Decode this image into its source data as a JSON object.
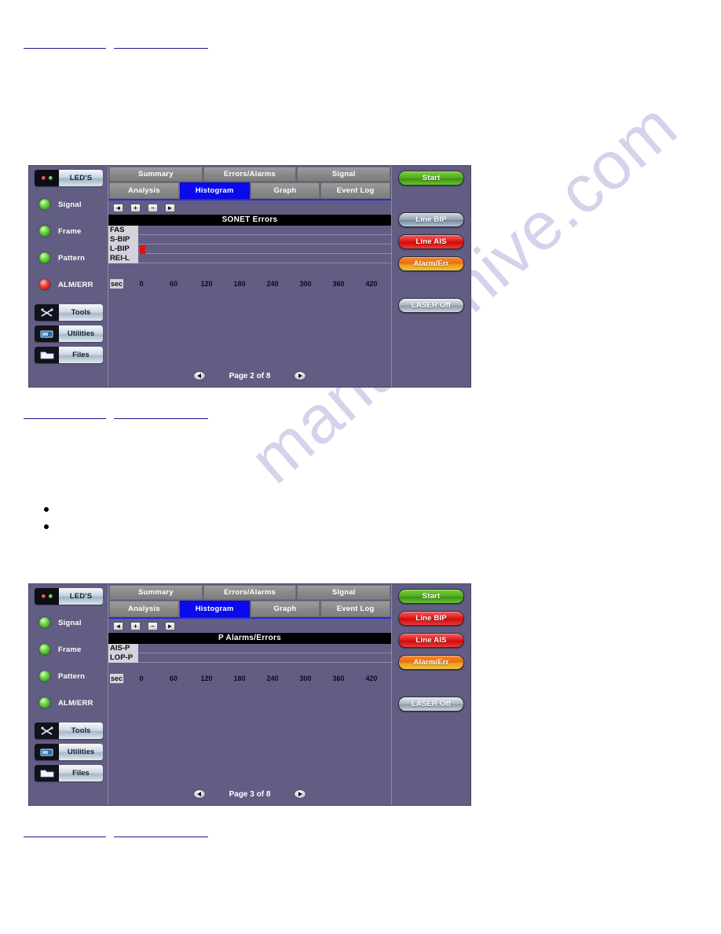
{
  "page": {
    "watermark": "manualshive.com",
    "watermark_color": "#b9badf",
    "background": "#ffffff"
  },
  "theme": {
    "panel_bg": "#625d82",
    "tab_bg": "#8a8a8a",
    "tab_active_bg": "#0a0aee",
    "title_bar_bg": "#000000",
    "gridline": "#8f8ca8",
    "bar_red": "#ee0b0b",
    "label_bg": "#d4d2dd"
  },
  "rules": [
    {
      "a_label": "",
      "b_label": ""
    },
    {
      "a_label": "",
      "b_label": ""
    },
    {
      "a_label": "",
      "b_label": ""
    }
  ],
  "bullets": [
    "",
    ""
  ],
  "screens": [
    {
      "id": "screen-sonet-errors",
      "sidebar": {
        "header": {
          "label": "LED'S",
          "icon": "led-indicator-icon",
          "dots": [
            "red",
            "green"
          ]
        },
        "leds": [
          {
            "label": "Signal",
            "color": "green"
          },
          {
            "label": "Frame",
            "color": "green"
          },
          {
            "label": "Pattern",
            "color": "green"
          },
          {
            "label": "ALM/ERR",
            "color": "red"
          }
        ],
        "tools": [
          {
            "label": "Tools",
            "icon": "tools-icon"
          },
          {
            "label": "Utilities",
            "icon": "utilities-icon"
          },
          {
            "label": "Files",
            "icon": "files-icon"
          }
        ]
      },
      "tabs_row1": [
        {
          "label": "Summary",
          "active": false
        },
        {
          "label": "Errors/Alarms",
          "active": false
        },
        {
          "label": "Signal",
          "active": false
        }
      ],
      "tabs_row2": [
        {
          "label": "Analysis",
          "active": false
        },
        {
          "label": "Histogram",
          "active": true
        },
        {
          "label": "Graph",
          "active": false
        },
        {
          "label": "Event Log",
          "active": false
        }
      ],
      "nav_buttons": [
        {
          "glyph": "◄",
          "name": "scroll-left-button"
        },
        {
          "glyph": "+",
          "name": "zoom-in-button"
        },
        {
          "glyph": "–",
          "name": "zoom-out-button"
        },
        {
          "glyph": "►",
          "name": "scroll-right-button"
        }
      ],
      "chart_data": {
        "type": "heatmap",
        "title": "SONET Errors",
        "xlabel": "sec",
        "ylabel": "",
        "categories": [
          "FAS",
          "S-BIP",
          "L-BIP",
          "REI-L"
        ],
        "x_ticks": [
          0,
          60,
          120,
          180,
          240,
          300,
          360,
          420
        ],
        "xlim": [
          0,
          450
        ],
        "grid": true,
        "legend": "none",
        "events": [
          {
            "row": "L-BIP",
            "row_index": 2,
            "t_start": 0,
            "t_end": 8,
            "color": "#ee0b0b"
          }
        ]
      },
      "pager": {
        "text": "Page 2 of 8",
        "prev": "previous-page",
        "next": "next-page"
      },
      "right_buttons": [
        {
          "label": "Start",
          "style": "green"
        },
        {
          "label": "Line BIP",
          "style": "gray"
        },
        {
          "label": "Line AIS",
          "style": "red"
        },
        {
          "label": "Alarm/Err",
          "style": "orange"
        },
        {
          "label": "LASER Off",
          "style": "silver"
        }
      ]
    },
    {
      "id": "screen-p-alarms-errors",
      "sidebar": {
        "header": {
          "label": "LED'S",
          "icon": "led-indicator-icon",
          "dots": [
            "red",
            "green"
          ]
        },
        "leds": [
          {
            "label": "Signal",
            "color": "green"
          },
          {
            "label": "Frame",
            "color": "green"
          },
          {
            "label": "Pattern",
            "color": "green"
          },
          {
            "label": "ALM/ERR",
            "color": "green"
          }
        ],
        "tools": [
          {
            "label": "Tools",
            "icon": "tools-icon"
          },
          {
            "label": "Utilities",
            "icon": "utilities-icon"
          },
          {
            "label": "Files",
            "icon": "files-icon"
          }
        ]
      },
      "tabs_row1": [
        {
          "label": "Summary",
          "active": false
        },
        {
          "label": "Errors/Alarms",
          "active": false
        },
        {
          "label": "Signal",
          "active": false
        }
      ],
      "tabs_row2": [
        {
          "label": "Analysis",
          "active": false
        },
        {
          "label": "Histogram",
          "active": true
        },
        {
          "label": "Graph",
          "active": false
        },
        {
          "label": "Event Log",
          "active": false
        }
      ],
      "nav_buttons": [
        {
          "glyph": "◄",
          "name": "scroll-left-button"
        },
        {
          "glyph": "+",
          "name": "zoom-in-button"
        },
        {
          "glyph": "–",
          "name": "zoom-out-button"
        },
        {
          "glyph": "►",
          "name": "scroll-right-button"
        }
      ],
      "chart_data": {
        "type": "heatmap",
        "title": "P Alarms/Errors",
        "xlabel": "sec",
        "ylabel": "",
        "categories": [
          "AIS-P",
          "LOP-P"
        ],
        "x_ticks": [
          0,
          60,
          120,
          180,
          240,
          300,
          360,
          420
        ],
        "xlim": [
          0,
          450
        ],
        "grid": true,
        "legend": "none",
        "events": []
      },
      "pager": {
        "text": "Page 3 of 8",
        "prev": "previous-page",
        "next": "next-page"
      },
      "right_buttons": [
        {
          "label": "Start",
          "style": "green"
        },
        {
          "label": "Line BIP",
          "style": "red"
        },
        {
          "label": "Line AIS",
          "style": "red"
        },
        {
          "label": "Alarm/Err",
          "style": "orange"
        },
        {
          "label": "LASER Off",
          "style": "silver"
        }
      ]
    }
  ]
}
